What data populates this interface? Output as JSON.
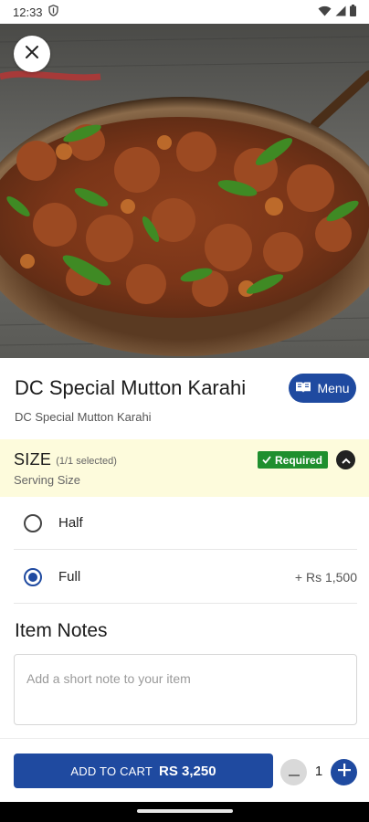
{
  "status_bar": {
    "time": "12:33"
  },
  "item": {
    "title": "DC Special Mutton Karahi",
    "subtitle": "DC Special Mutton Karahi",
    "menu_label": "Menu"
  },
  "size_group": {
    "title": "SIZE",
    "selected_info": "(1/1 selected)",
    "subtitle": "Serving Size",
    "required_label": "Required",
    "options": [
      {
        "label": "Half",
        "price": "",
        "selected": false
      },
      {
        "label": "Full",
        "price": "+ Rs 1,500",
        "selected": true
      }
    ]
  },
  "notes": {
    "title": "Item Notes",
    "placeholder": "Add a short note to your item"
  },
  "cart": {
    "add_label": "ADD TO CART",
    "amount": "RS 3,250",
    "quantity": "1"
  },
  "colors": {
    "primary": "#1f4aa0",
    "required": "#1f8f2e",
    "section_bg": "#fdfbdc"
  },
  "icons": [
    "shield-status-icon",
    "wifi-icon",
    "signal-icon",
    "battery-icon",
    "close-icon",
    "menu-book-icon",
    "check-icon",
    "chevron-up-icon",
    "minus-icon",
    "plus-icon"
  ]
}
